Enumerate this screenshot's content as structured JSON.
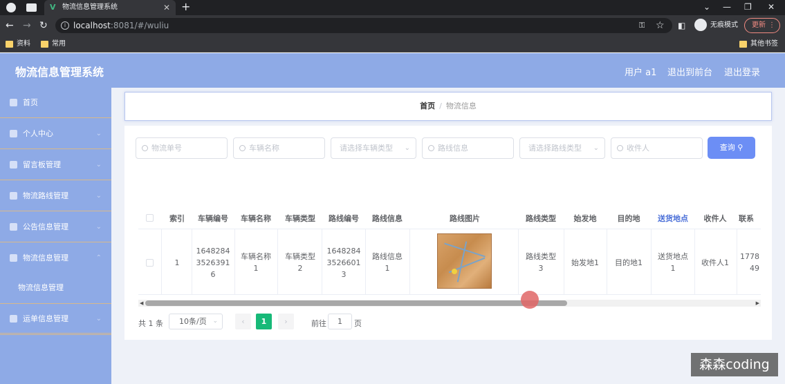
{
  "browser": {
    "tab_title": "物流信息管理系统",
    "url_host": "localhost",
    "url_rest": ":8081/#/wuliu",
    "incognito_label": "无痕模式",
    "update_label": "更新",
    "bookmarks": [
      "资料",
      "常用",
      "其他书签"
    ]
  },
  "header": {
    "app_title": "物流信息管理系统",
    "user_label": "用户 a1",
    "back_to_front": "退出到前台",
    "logout": "退出登录"
  },
  "sidebar": {
    "items": [
      {
        "label": "首页",
        "icon": "home-icon",
        "has_arrow": false
      },
      {
        "label": "个人中心",
        "icon": "user-icon",
        "has_arrow": true
      },
      {
        "label": "留言板管理",
        "icon": "message-icon",
        "has_arrow": true
      },
      {
        "label": "物流路线管理",
        "icon": "user-icon",
        "has_arrow": true
      },
      {
        "label": "公告信息管理",
        "icon": "user-icon",
        "has_arrow": true
      },
      {
        "label": "物流信息管理",
        "icon": "document-icon",
        "has_arrow": true
      },
      {
        "label": "运单信息管理",
        "icon": "send-icon",
        "has_arrow": true
      }
    ],
    "submenu": {
      "label": "物流信息管理"
    }
  },
  "breadcrumb": {
    "home": "首页",
    "separator": "/",
    "current": "物流信息"
  },
  "search": {
    "tracking_no": "物流单号",
    "vehicle_name": "车辆名称",
    "vehicle_type": "请选择车辆类型",
    "route_info": "路线信息",
    "route_type": "请选择路线类型",
    "receiver": "收件人",
    "query_button": "查询"
  },
  "table": {
    "headers": [
      "索引",
      "车辆编号",
      "车辆名称",
      "车辆类型",
      "路线编号",
      "路线信息",
      "路线图片",
      "路线类型",
      "始发地",
      "目的地",
      "送货地点",
      "收件人",
      "联系"
    ],
    "row": {
      "index": "1",
      "vehicle_no": [
        "1648284",
        "3526391",
        "6"
      ],
      "vehicle_name": [
        "车辆名称",
        "1"
      ],
      "vehicle_type": [
        "车辆类型",
        "2"
      ],
      "route_no": [
        "1648284",
        "3526601",
        "3"
      ],
      "route_info": [
        "路线信息",
        "1"
      ],
      "route_type": [
        "路线类型",
        "3"
      ],
      "origin": "始发地1",
      "destination": "目的地1",
      "delivery": [
        "送货地点",
        "1"
      ],
      "receiver": "收件人1",
      "contact": [
        "1778",
        "49"
      ]
    }
  },
  "pagination": {
    "total": "共 1 条",
    "page_size": "10条/页",
    "prev": "‹",
    "current": "1",
    "next": "›",
    "goto_label": "前往",
    "goto_value": "1",
    "page_label": "页"
  },
  "watermark": "森森coding"
}
